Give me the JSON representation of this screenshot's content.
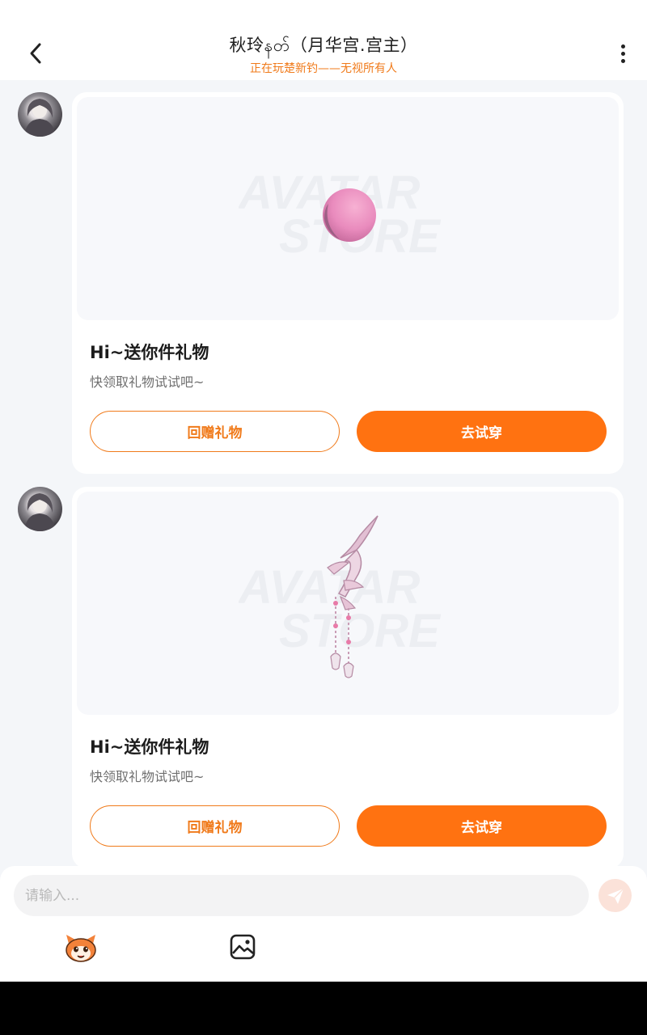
{
  "header": {
    "title": "秋玲နတ်（月华宫.宫主）",
    "subtitle": "正在玩楚新钓——无视所有人"
  },
  "messages": [
    {
      "image_icon": "pink-sphere-icon",
      "watermark_line1": "AVATAR",
      "watermark_line2": "STORE",
      "title": "Hi~送你件礼物",
      "description": "快领取礼物试试吧~",
      "return_gift_label": "回赠礼物",
      "try_on_label": "去试穿"
    },
    {
      "image_icon": "crystal-hairpin-icon",
      "watermark_line1": "AVATAR",
      "watermark_line2": "STORE",
      "title": "Hi~送你件礼物",
      "description": "快领取礼物试试吧~",
      "return_gift_label": "回赠礼物",
      "try_on_label": "去试穿"
    }
  ],
  "input": {
    "placeholder": "请输入..."
  },
  "colors": {
    "accent": "#ff7211",
    "accent_text": "#f07a1a",
    "send_button_bg": "#fbe2d9",
    "page_bg": "#f4f6f9"
  },
  "icons": {
    "back": "chevron-left-icon",
    "more": "more-vertical-icon",
    "send": "paper-plane-icon",
    "emoji": "mascot-emoji-icon",
    "image": "image-picker-icon"
  }
}
